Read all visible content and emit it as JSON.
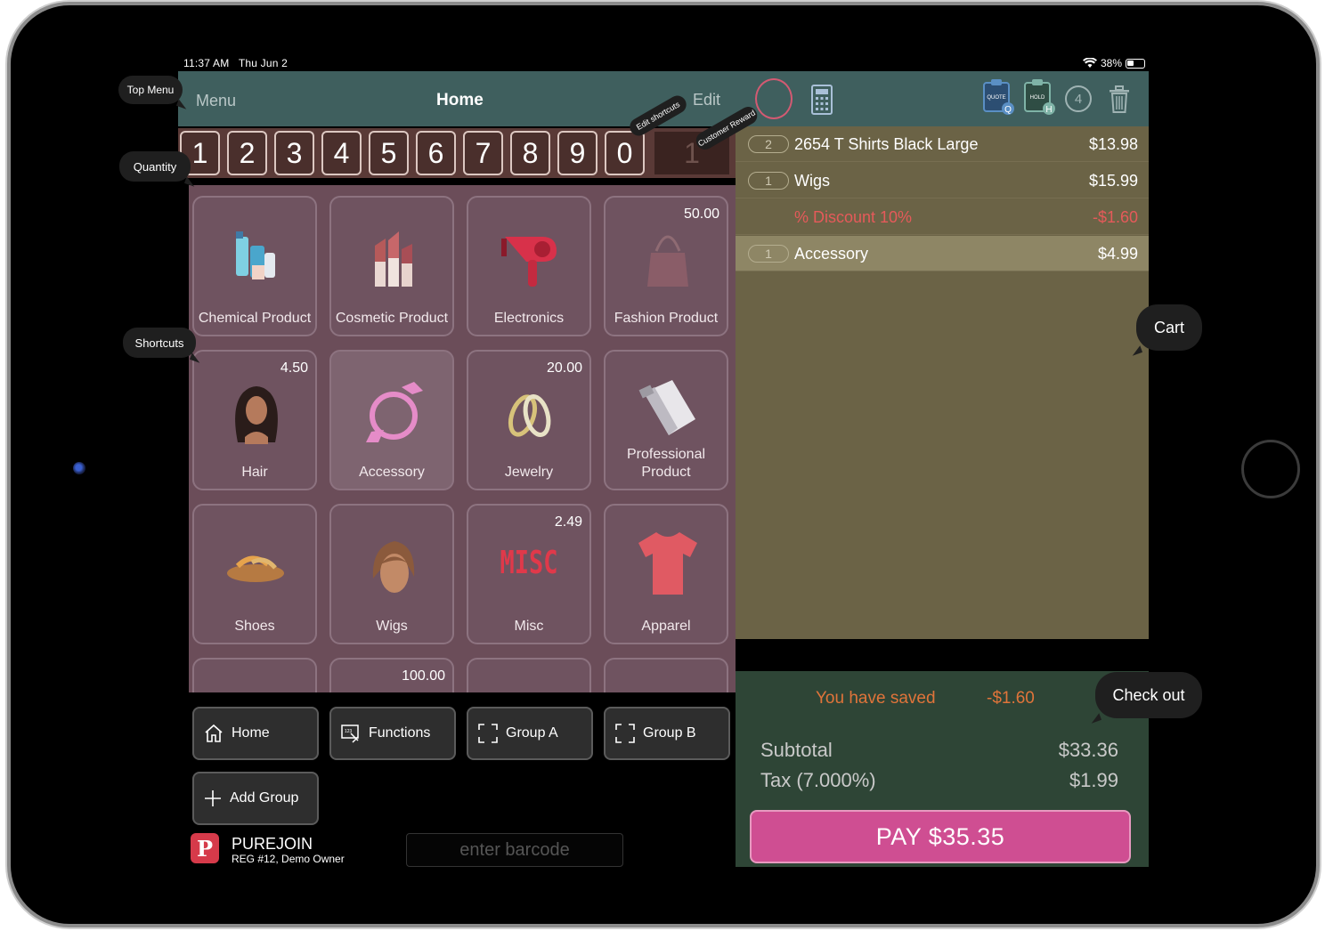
{
  "status_bar": {
    "time": "11:37 AM",
    "date": "Thu Jun 2",
    "battery": "38%"
  },
  "topbar": {
    "menu": "Menu",
    "title": "Home",
    "edit": "Edit",
    "hold_count": "4",
    "quote_badge": "Q",
    "hold_badge": "H",
    "quote_text": "QUOTE",
    "hold_text": "HOLD"
  },
  "quantity_keys": [
    "1",
    "2",
    "3",
    "4",
    "5",
    "6",
    "7",
    "8",
    "9",
    "0"
  ],
  "quantity_display": "1",
  "shortcuts": [
    {
      "label": "Chemical Product",
      "price": "",
      "icon": "chemical-products-icon"
    },
    {
      "label": "Cosmetic Product",
      "price": "",
      "icon": "lipstick-icon"
    },
    {
      "label": "Electronics",
      "price": "",
      "icon": "hair-dryer-icon"
    },
    {
      "label": "Fashion Product",
      "price": "50.00",
      "icon": "handbag-icon"
    },
    {
      "label": "Hair",
      "price": "4.50",
      "icon": "hair-model-icon"
    },
    {
      "label": "Accessory",
      "price": "",
      "icon": "bow-headband-icon"
    },
    {
      "label": "Jewelry",
      "price": "20.00",
      "icon": "rings-icon"
    },
    {
      "label": "Professional Product",
      "price": "",
      "icon": "clipper-icon"
    },
    {
      "label": "Shoes",
      "price": "",
      "icon": "sandal-icon"
    },
    {
      "label": "Wigs",
      "price": "",
      "icon": "wig-icon"
    },
    {
      "label": "Misc",
      "price": "2.49",
      "icon": "misc-icon"
    },
    {
      "label": "Apparel",
      "price": "",
      "icon": "tshirt-icon"
    },
    {
      "label": "",
      "price": "",
      "icon": ""
    },
    {
      "label": "",
      "price": "100.00",
      "icon": ""
    },
    {
      "label": "",
      "price": "",
      "icon": ""
    },
    {
      "label": "",
      "price": "",
      "icon": ""
    }
  ],
  "misc_text": "MISC",
  "tabs": {
    "home": "Home",
    "functions": "Functions",
    "group_a": "Group A",
    "group_b": "Group B",
    "add_group": "Add Group"
  },
  "brand": {
    "logo": "P",
    "name": "PUREJOIN",
    "sub": "REG #12, Demo Owner"
  },
  "barcode": {
    "placeholder": "enter barcode"
  },
  "cart": {
    "items": [
      {
        "qty": "2",
        "name": "2654 T Shirts Black Large",
        "amount": "$13.98"
      },
      {
        "qty": "1",
        "name": "Wigs",
        "amount": "$15.99"
      },
      {
        "qty": "",
        "name": "% Discount 10%",
        "amount": "-$1.60"
      },
      {
        "qty": "1",
        "name": "Accessory",
        "amount": "$4.99"
      }
    ]
  },
  "totals": {
    "saved_label": "You have saved",
    "saved_amount": "-$1.60",
    "subtotal_label": "Subtotal",
    "subtotal": "$33.36",
    "tax_label": "Tax (7.000%)",
    "tax": "$1.99",
    "pay": "PAY $35.35"
  },
  "callouts": {
    "top_menu": "Top Menu",
    "quantity": "Quantity",
    "shortcuts": "Shortcuts",
    "edit_shortcuts": "Edit shortcuts",
    "customer_reward": "Customer Reward",
    "cart": "Cart",
    "check_out": "Check out"
  },
  "colors": {
    "topbar": "#3f5f5e",
    "grid": "#6b4d59",
    "cart": "#6b6346",
    "totals": "#2e4536",
    "pay": "#cf4e92",
    "discount": "#e55a5a",
    "saved": "#e0743a"
  }
}
